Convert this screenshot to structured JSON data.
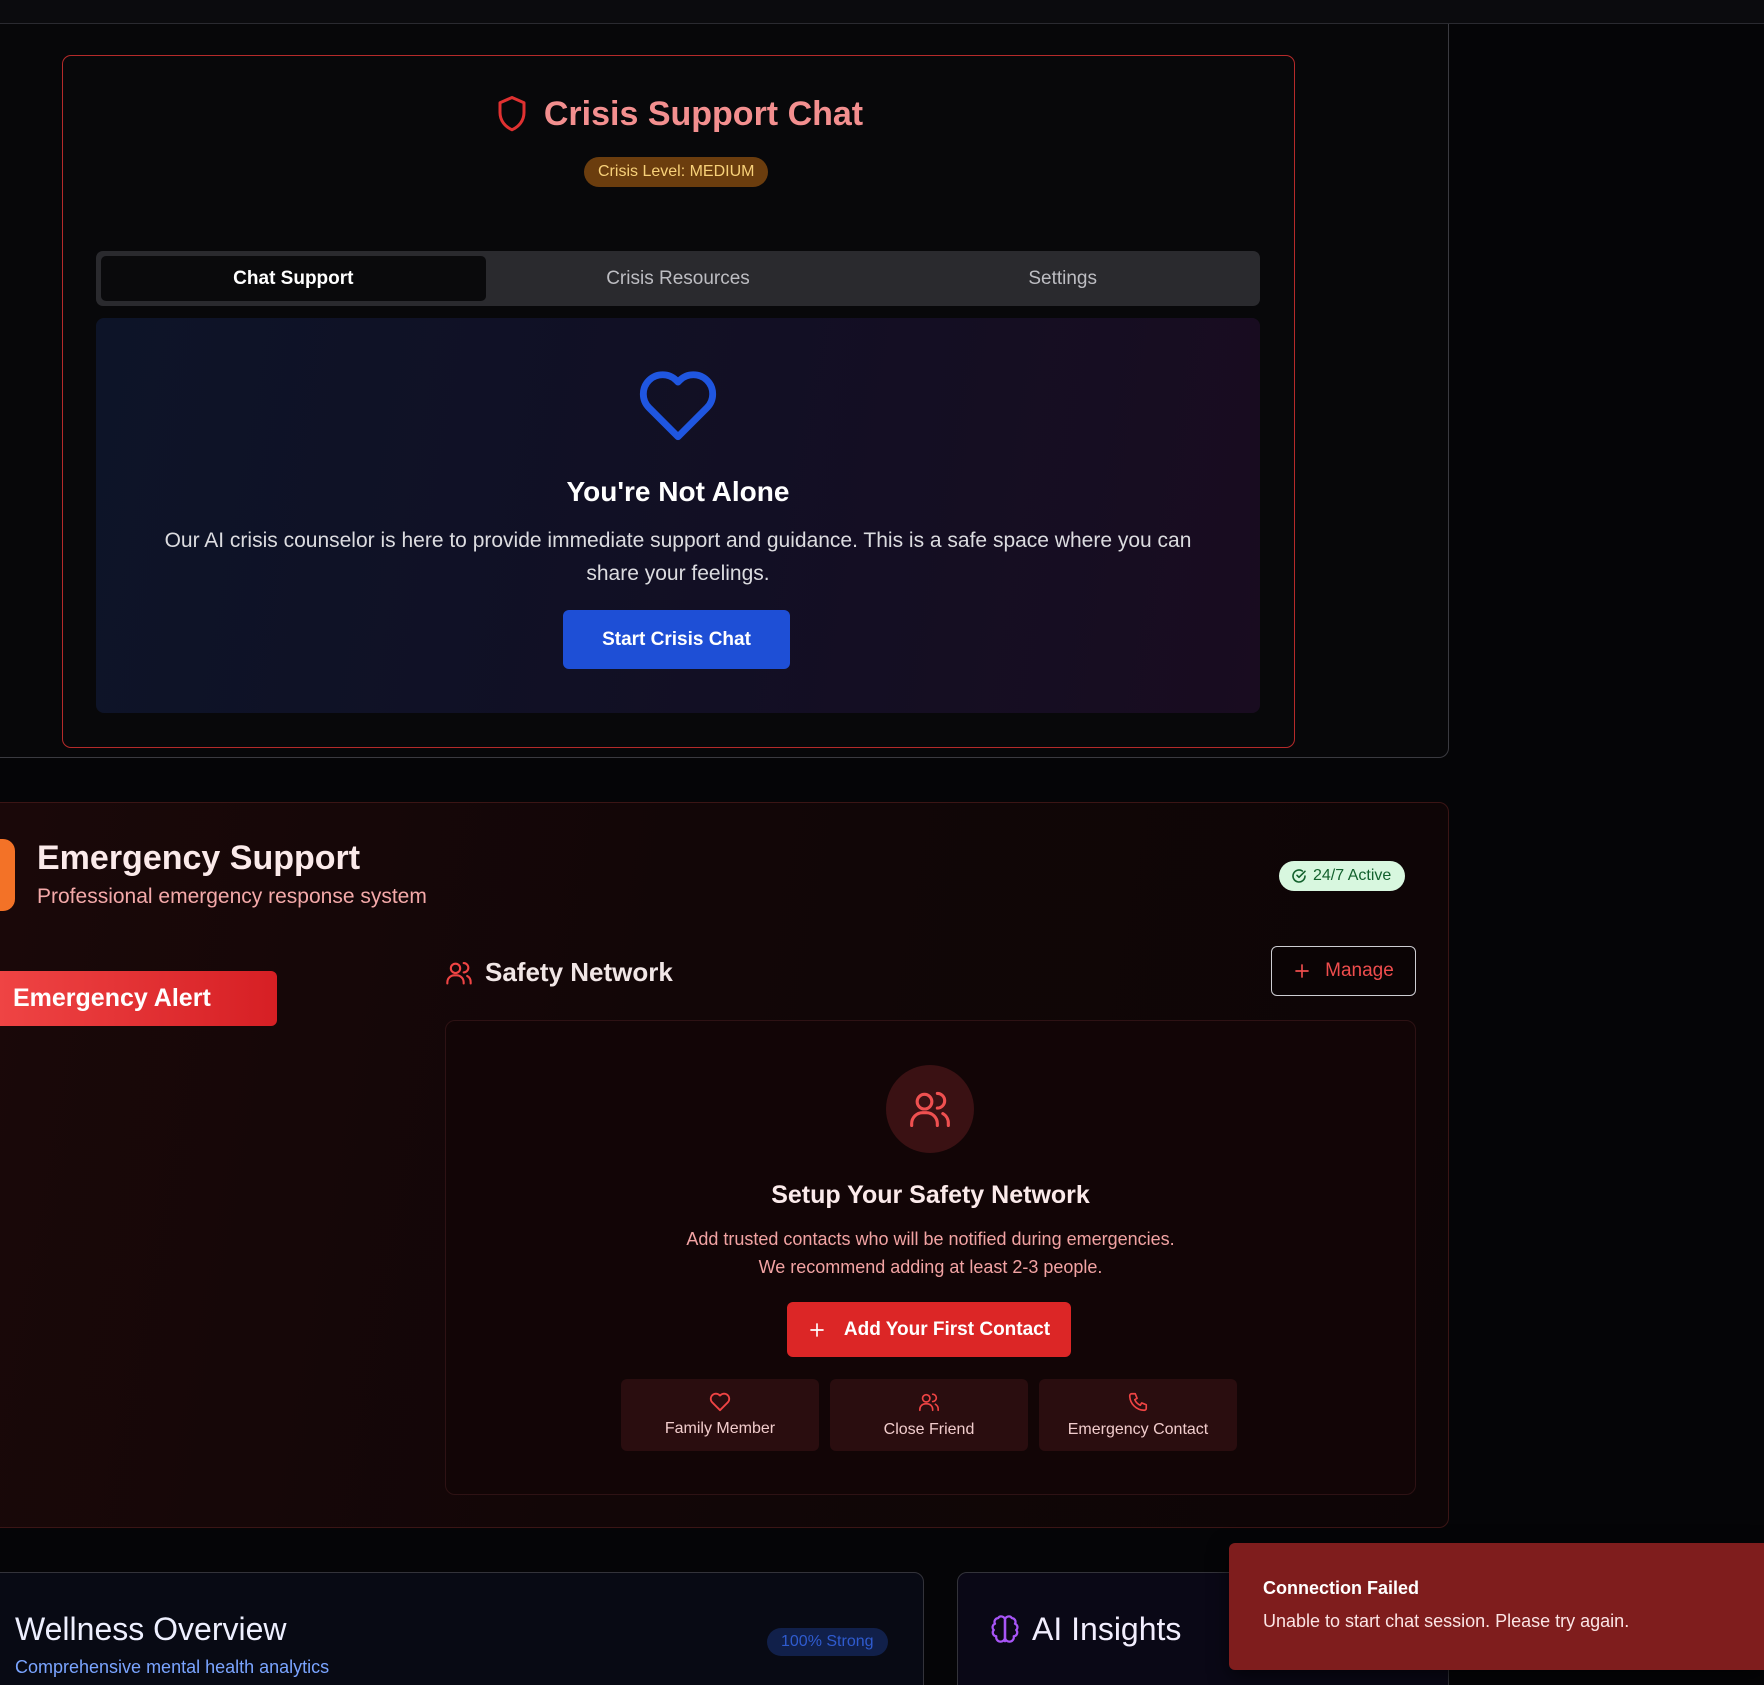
{
  "crisis": {
    "title": "Crisis Support Chat",
    "level_badge": "Crisis Level: MEDIUM",
    "tabs": [
      {
        "label": "Chat Support",
        "active": true
      },
      {
        "label": "Crisis Resources",
        "active": false
      },
      {
        "label": "Settings",
        "active": false
      }
    ],
    "panel": {
      "icon": "heart-icon",
      "title": "You're Not Alone",
      "text": "Our AI crisis counselor is here to provide immediate support and guidance. This is a safe space where you can share your feelings.",
      "button": "Start Crisis Chat"
    }
  },
  "emergency": {
    "title": "Emergency Support",
    "subtitle": "Professional emergency response system",
    "status_badge": "24/7 Active",
    "alert_button": "Emergency Alert",
    "safety_network": {
      "title": "Safety Network",
      "manage_button": "Manage",
      "setup_title": "Setup Your Safety Network",
      "setup_text_line1": "Add trusted contacts who will be notified during emergencies.",
      "setup_text_line2": "We recommend adding at least 2-3 people.",
      "add_button": "Add Your First Contact",
      "options": [
        {
          "label": "Family Member",
          "icon": "heart-icon"
        },
        {
          "label": "Close Friend",
          "icon": "users-icon"
        },
        {
          "label": "Emergency Contact",
          "icon": "phone-icon"
        }
      ]
    }
  },
  "wellness": {
    "title": "Wellness Overview",
    "subtitle": "Comprehensive mental health analytics",
    "badge": "100% Strong"
  },
  "insights": {
    "title": "AI Insights",
    "icon": "brain-icon"
  },
  "toast": {
    "title": "Connection Failed",
    "message": "Unable to start chat session. Please try again."
  },
  "colors": {
    "brand_red": "#dc2626",
    "brand_blue": "#1e4fd6",
    "toast_bg": "#7f1d1d",
    "badge_amber": "#6b3d0e"
  }
}
